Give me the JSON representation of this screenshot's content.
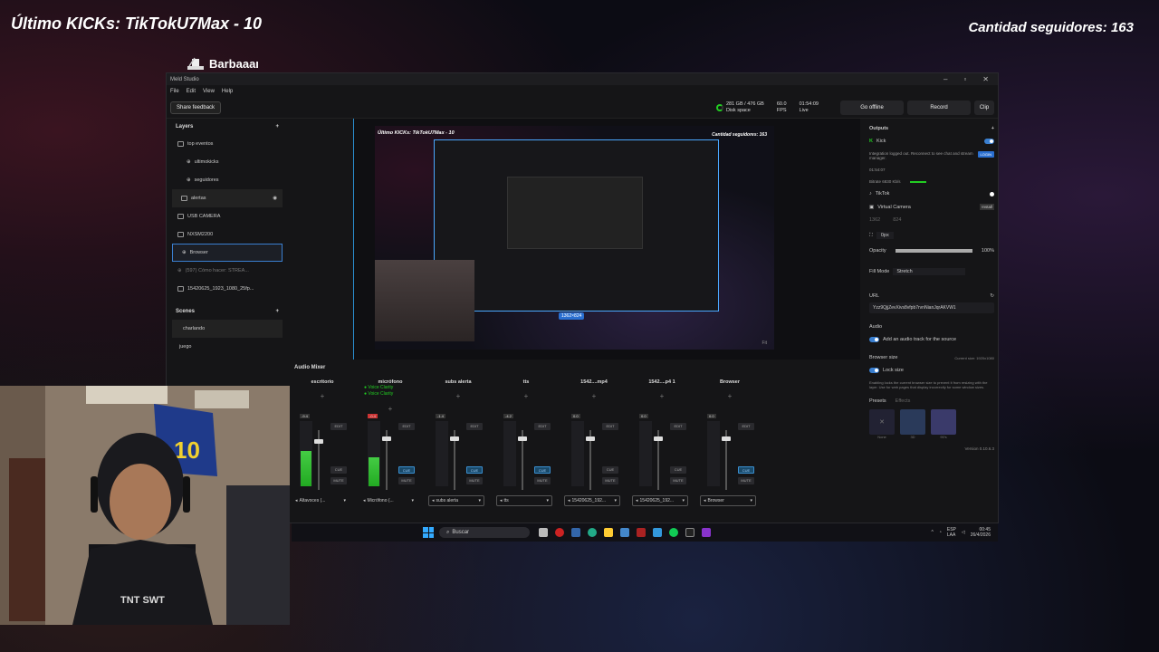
{
  "overlay": {
    "last_kicks": "Último KICKs: TikTokU7Max - 10",
    "followers": "Cantidad seguidores: 163",
    "brand": "Barbaaaı"
  },
  "app": {
    "title": "Meld Studio",
    "menu": [
      "File",
      "Edit",
      "View",
      "Help"
    ],
    "share_feedback": "Share feedback",
    "disk": {
      "value": "281 GB / 476 GB",
      "label": "Disk space"
    },
    "fps": {
      "value": "60.0",
      "label": "FPS"
    },
    "live": {
      "value": "01:54:09",
      "label": "Live"
    },
    "buttons": {
      "go_offline": "Go offline",
      "record": "Record",
      "clip": "Clip"
    },
    "layers": {
      "title": "Layers",
      "items": [
        {
          "label": "top eventos",
          "level": 0
        },
        {
          "label": "ultimokicks",
          "level": 1
        },
        {
          "label": "seguidores",
          "level": 1
        },
        {
          "label": "alertas",
          "level": 0
        },
        {
          "label": "USB CAMERA",
          "level": 0
        },
        {
          "label": "NXSM2200",
          "level": 0
        },
        {
          "label": "Browser",
          "level": 0
        },
        {
          "label": "(597) Cómo hacer: STREA...",
          "level": 0
        },
        {
          "label": "15420625_1923_1080_25fp...",
          "level": 0
        }
      ]
    },
    "scenes": {
      "title": "Scenes",
      "items": [
        "charlando",
        "juego"
      ]
    },
    "preview": {
      "left_text": "Último KICKs: TikTokU7Max - 10",
      "right_text": "Cantidad seguidores: 163",
      "size_badge": "1362×824",
      "fit": "Fit"
    },
    "mixer": {
      "title": "Audio Mixer",
      "channels": [
        {
          "name": "escritorio",
          "output": "Altavoces (...",
          "level": 0.55,
          "fader": 0.15,
          "cue": false,
          "db": "-9.4"
        },
        {
          "name": "micrófono",
          "output": "Micrófono (...",
          "level": 0.45,
          "fader": 0.1,
          "cue": true,
          "db": "-0.4",
          "fx": [
            "Voice Clarity",
            "Voice Clarity"
          ]
        },
        {
          "name": "subs alerta",
          "output": "subs alerta",
          "level": 0,
          "fader": 0.1,
          "cue": true,
          "db": "-1.4"
        },
        {
          "name": "tts",
          "output": "tts",
          "level": 0,
          "fader": 0.1,
          "cue": true,
          "db": "-4.2"
        },
        {
          "name": "1542....mp4",
          "output": "15420625_192...",
          "level": 0,
          "fader": 0.1,
          "cue": false,
          "db": "0.0"
        },
        {
          "name": "1542....p4 1",
          "output": "15420625_192...",
          "level": 0,
          "fader": 0.1,
          "cue": false,
          "db": "0.0"
        },
        {
          "name": "Browser",
          "output": "Browser",
          "level": 0,
          "fader": 0.1,
          "cue": true,
          "db": "0.0"
        }
      ]
    },
    "outputs": {
      "title": "Outputs",
      "kick": "Kick",
      "kick_msg": "Integration logged out. Reconnect to see chat and stream manager.",
      "login": "LOGIN",
      "kick_time": "01:54:07",
      "bitrate": "Bitrate  6830 Kb/s",
      "tiktok": "TikTok",
      "virtual_camera": "Virtual Camera",
      "install": "Install"
    },
    "props": {
      "x": "1362",
      "y": "824",
      "px": "0px",
      "opacity_label": "Opacity",
      "opacity_value": "100%",
      "opacity": 1.0,
      "fill_label": "Fill Mode",
      "fill_value": "Stretch",
      "url_label": "URL",
      "url_value": "Yzz9QjjZevXivs8vfpb7rvnNianJqrAKVW1",
      "audio_label": "Audio",
      "audio_toggle": "Add an audio track for the source",
      "browser_size": "Browser size",
      "current_size": "Current size: 1920x1080",
      "lock_size": "Lock size",
      "lock_note": "Enabling locks the current browser size to prevent it from resizing with the layer. Use for web pages that display incorrectly for some window sizes.",
      "presets": "Presets",
      "effects": "Effects",
      "preset_items": [
        "None",
        "3D",
        "90's"
      ],
      "version": "Version 0.10.6.3"
    }
  },
  "taskbar": {
    "search": "Buscar",
    "lang_top": "ESP",
    "lang_bottom": "LAA",
    "time": "00:45",
    "date": "26/4/2026"
  }
}
